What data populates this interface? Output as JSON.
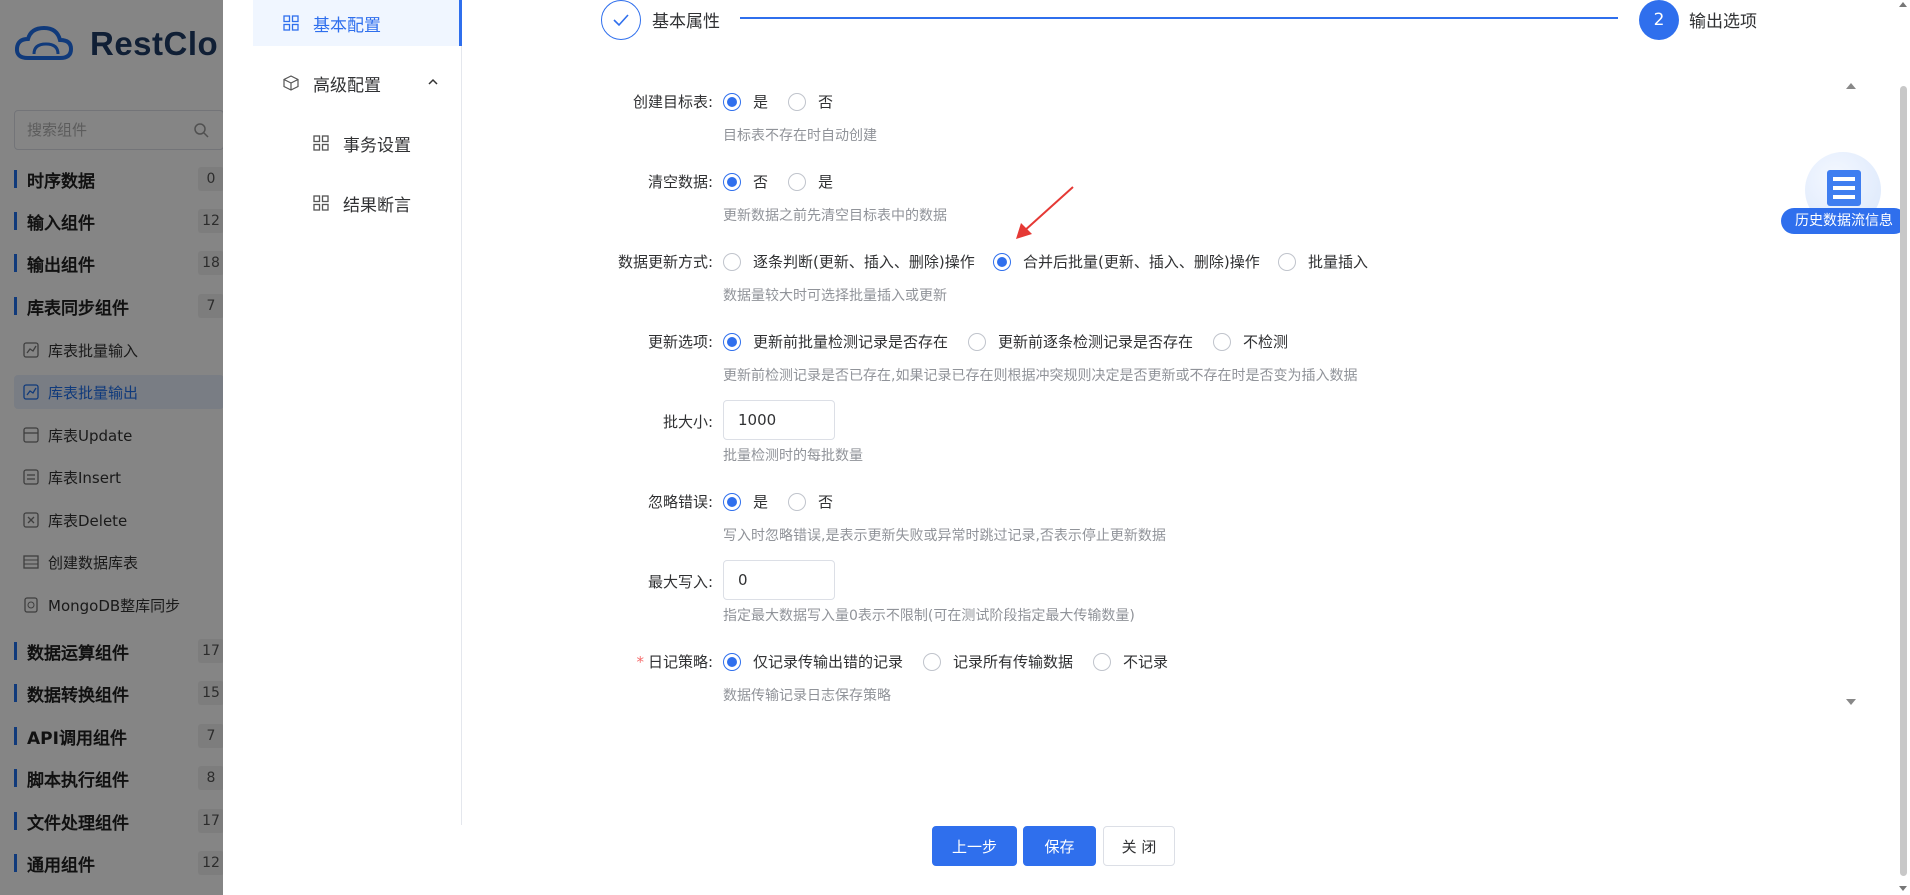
{
  "app": {
    "brand": "RestClo",
    "search_placeholder": "搜索组件",
    "categories": [
      {
        "label": "时序数据",
        "count": "0"
      },
      {
        "label": "输入组件",
        "count": "12"
      },
      {
        "label": "输出组件",
        "count": "18"
      },
      {
        "label": "库表同步组件",
        "count": "7"
      },
      {
        "label": "数据运算组件",
        "count": "17"
      },
      {
        "label": "数据转换组件",
        "count": "15"
      },
      {
        "label": "API调用组件",
        "count": "7"
      },
      {
        "label": "脚本执行组件",
        "count": "8"
      },
      {
        "label": "文件处理组件",
        "count": "17"
      },
      {
        "label": "通用组件",
        "count": "12"
      }
    ],
    "sync_items": [
      "库表批量输入",
      "库表批量输出",
      "库表Update",
      "库表Insert",
      "库表Delete",
      "创建数据库表",
      "MongoDB整库同步"
    ]
  },
  "dialog": {
    "nav": {
      "basic": "基本配置",
      "advanced": "高级配置",
      "transaction": "事务设置",
      "assertion": "结果断言"
    },
    "steps": {
      "step1_label": "基本属性",
      "step2_number": "2",
      "step2_label": "输出选项"
    },
    "form": {
      "create_table": {
        "label": "创建目标表:",
        "options": [
          "是",
          "否"
        ],
        "hint": "目标表不存在时自动创建"
      },
      "clear_data": {
        "label": "清空数据:",
        "options": [
          "否",
          "是"
        ],
        "hint": "更新数据之前先清空目标表中的数据"
      },
      "update_mode": {
        "label": "数据更新方式:",
        "options": [
          "逐条判断(更新、插入、删除)操作",
          "合并后批量(更新、插入、删除)操作",
          "批量插入"
        ],
        "hint": "数据量较大时可选择批量插入或更新"
      },
      "update_option": {
        "label": "更新选项:",
        "options": [
          "更新前批量检测记录是否存在",
          "更新前逐条检测记录是否存在",
          "不检测"
        ],
        "hint": "更新前检测记录是否已存在,如果记录已存在则根据冲突规则决定是否更新或不存在时是否变为插入数据"
      },
      "batch_size": {
        "label": "批大小:",
        "value": "1000",
        "hint": "批量检测时的每批数量"
      },
      "ignore_error": {
        "label": "忽略错误:",
        "options": [
          "是",
          "否"
        ],
        "hint": "写入时忽略错误,是表示更新失败或异常时跳过记录,否表示停止更新数据"
      },
      "max_write": {
        "label": "最大写入:",
        "value": "0",
        "hint": "指定最大数据写入量0表示不限制(可在测试阶段指定最大传输数量)"
      },
      "log_policy": {
        "label": "日记策略:",
        "required_mark": "*",
        "options": [
          "仅记录传输出错的记录",
          "记录所有传输数据",
          "不记录"
        ],
        "hint": "数据传输记录日志保存策略"
      }
    },
    "history_label": "历史数据流信息",
    "buttons": {
      "prev": "上一步",
      "save": "保存",
      "close": "关 闭"
    },
    "colors": {
      "primary": "#2f6fed",
      "annotation_arrow": "#e53935"
    }
  }
}
